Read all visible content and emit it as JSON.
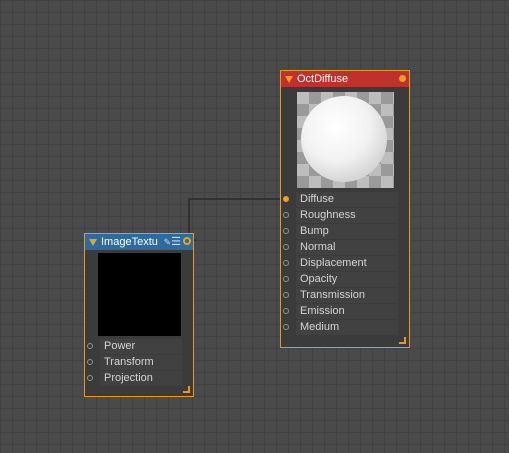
{
  "nodes": {
    "oct_diffuse": {
      "title": "OctDiffuse",
      "header_color": "#c0302c",
      "inputs": [
        "Diffuse",
        "Roughness",
        "Bump",
        "Normal",
        "Displacement",
        "Opacity",
        "Transmission",
        "Emission",
        "Medium"
      ],
      "connected_input": "Diffuse"
    },
    "image_texture": {
      "title": "ImageTextu",
      "header_color": "#2d6a9e",
      "inputs": [
        "Power",
        "Transform",
        "Projection"
      ]
    }
  },
  "colors": {
    "canvas": "#4a4a4a",
    "node_border": "#e39a1e",
    "wire": "#2a2a2a"
  }
}
